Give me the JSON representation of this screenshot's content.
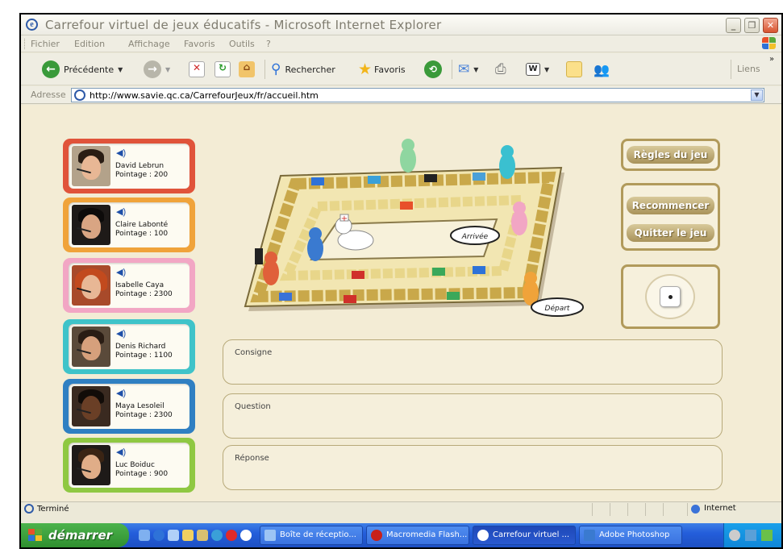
{
  "window": {
    "title": "Carrefour virtuel de jeux éducatifs - Microsoft Internet Explorer"
  },
  "menu": [
    "Fichier",
    "Edition",
    "Affichage",
    "Favoris",
    "Outils",
    "?"
  ],
  "toolbar": {
    "back": "Précédente",
    "search": "Rechercher",
    "favorites": "Favoris",
    "links": "Liens"
  },
  "address": {
    "label": "Adresse",
    "url": "http://www.savie.qc.ca/CarrefourJeux/fr/accueil.htm"
  },
  "players": [
    {
      "name": "David Lebrun",
      "score": "Pointage : 200",
      "color": "#e0533a"
    },
    {
      "name": "Claire Labonté",
      "score": "Pointage : 100",
      "color": "#f0a33a"
    },
    {
      "name": "Isabelle Caya",
      "score": "Pointage : 2300",
      "color": "#f2a6c4"
    },
    {
      "name": "Denis Richard",
      "score": "Pointage : 1100",
      "color": "#3fc3c9"
    },
    {
      "name": "Maya Lesoleil",
      "score": "Pointage : 2300",
      "color": "#2f7fc2"
    },
    {
      "name": "Luc Boiduc",
      "score": "Pointage : 900",
      "color": "#8fc842"
    }
  ],
  "buttons": {
    "rules": "Règles du jeu",
    "restart": "Recommencer",
    "quit": "Quitter le jeu"
  },
  "board": {
    "arrival": "Arrivée",
    "departure": "Départ"
  },
  "panels": {
    "instruction": "Consigne",
    "question": "Question",
    "answer": "Réponse"
  },
  "status": {
    "text": "Terminé",
    "zone": "Internet"
  },
  "taskbar": {
    "start": "démarrer",
    "tasks": [
      "Boîte de réceptio...",
      "Macromedia Flash...",
      "Carrefour virtuel ...",
      "Adobe Photoshop"
    ]
  }
}
